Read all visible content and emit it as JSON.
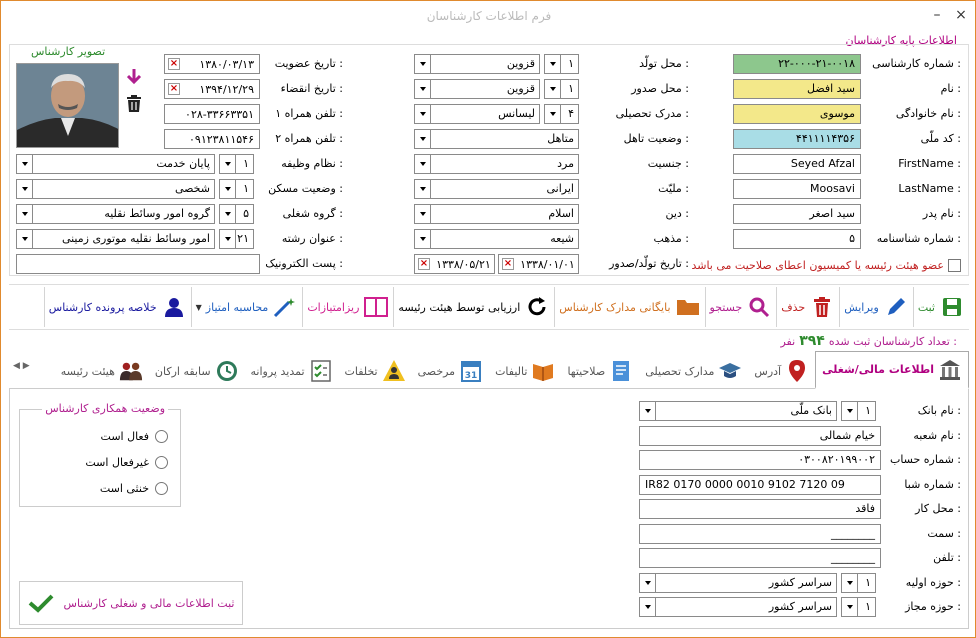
{
  "window": {
    "title": "فرم اطلاعات کارشناسان",
    "close": "×",
    "minimize": "–"
  },
  "section_title": "اطلاعات پایه کارشناسان",
  "photo_label": "تصویر کارشناس",
  "col1": [
    {
      "label": "شماره کارشناسی :",
      "value": "۲۲-۰۰۰-۲۱-۰۰۱۸"
    },
    {
      "label": "نام :",
      "value": "سید افضل"
    },
    {
      "label": "نام خانوادگی :",
      "value": "موسوی"
    },
    {
      "label": "کد ملّی :",
      "value": "۴۴۱۱۱۱۴۳۵۶"
    },
    {
      "label": "FirstName :",
      "value": "Seyed Afzal"
    },
    {
      "label": "LastName :",
      "value": "Moosavi"
    },
    {
      "label": "نام پدر :",
      "value": "سید اصغر"
    },
    {
      "label": "شماره شناسنامه :",
      "value": "۵"
    }
  ],
  "committee_check": "عضو هیئت رئیسه یا کمیسیون اعطای صلاحیت می باشد",
  "col2": [
    {
      "label": "محل تولّد :",
      "code": "۱",
      "value": "قزوین"
    },
    {
      "label": "محل صدور :",
      "code": "۱",
      "value": "قزوین"
    },
    {
      "label": "مدرک تحصیلی :",
      "code": "۴",
      "value": "لیسانس"
    },
    {
      "label": "وضعیت تاهل :",
      "code": "",
      "value": "متاهل"
    },
    {
      "label": "جنسیت :",
      "code": "",
      "value": "مرد"
    },
    {
      "label": "ملیّت :",
      "code": "",
      "value": "ایرانی"
    },
    {
      "label": "دین :",
      "code": "",
      "value": "اسلام"
    },
    {
      "label": "مذهب :",
      "code": "",
      "value": "شیعه"
    }
  ],
  "birth_issue": {
    "label": "تاریخ تولّد/صدور :",
    "birth": "۱۳۳۸/۰۱/۰۱",
    "issue": "۱۳۳۸/۰۵/۲۱"
  },
  "col3": [
    {
      "label": "تاریخ عضویت :",
      "value": "۱۳۸۰/۰۳/۱۳",
      "x": true
    },
    {
      "label": "تاریخ انقضاء :",
      "value": "۱۳۹۴/۱۲/۲۹",
      "x": true
    },
    {
      "label": "تلفن همراه ۱ :",
      "value": "۰۲۸-۳۳۶۶۳۳۵۱",
      "x": false
    },
    {
      "label": "تلفن همراه ۲ :",
      "value": "۰۹۱۲۳۸۱۱۵۴۶",
      "x": false
    }
  ],
  "col3_dd": [
    {
      "label": "نظام وظیفه :",
      "code": "۱",
      "value": "پایان خدمت"
    },
    {
      "label": "وضعیت مسکن :",
      "code": "۱",
      "value": "شخصی"
    },
    {
      "label": "گروه شغلی :",
      "code": "۵",
      "value": "گروه امور وسائط نقلیه"
    },
    {
      "label": "عنوان رشته :",
      "code": "۲۱",
      "value": "امور وسائط نقلیه موتوری زمینی"
    }
  ],
  "email_label": "پست الکترونیک :",
  "toolbar": [
    {
      "label": "ثبت",
      "icon": "save-icon",
      "color": "#2e8b2e"
    },
    {
      "label": "ویرایش",
      "icon": "edit-icon",
      "color": "#1f5fbf"
    },
    {
      "label": "حذف",
      "icon": "trash-icon",
      "color": "#c02020"
    },
    {
      "label": "جستجو",
      "icon": "search-icon",
      "color": "#b0208f"
    },
    {
      "label": "بایگانی مدارک کارشناس",
      "icon": "folder-icon",
      "color": "#d07020"
    },
    {
      "label": "ارزیابی توسط هیئت رئیسه",
      "icon": "refresh-icon",
      "color": "#000000"
    },
    {
      "label": "ریزامتیازات",
      "icon": "columns-icon",
      "color": "#d0208f"
    },
    {
      "label": "محاسبه امتیاز",
      "icon": "wand-icon",
      "color": "#1f5fbf"
    },
    {
      "label": "خلاصه پرونده کارشناس",
      "icon": "user-icon",
      "color": "#1a1a9f"
    }
  ],
  "count": {
    "label": "تعداد کارشناسان ثبت شده :",
    "value": "۳۹۴",
    "unit": "نفر"
  },
  "tabs": [
    {
      "label": "اطلاعات مالی/شغلی",
      "icon": "bank-icon",
      "active": true
    },
    {
      "label": "آدرس",
      "icon": "map-pin-icon"
    },
    {
      "label": "مدارک تحصیلی",
      "icon": "graduation-cap-icon"
    },
    {
      "label": "صلاحیتها",
      "icon": "document-icon"
    },
    {
      "label": "تالیفات",
      "icon": "book-icon"
    },
    {
      "label": "مرخصی",
      "icon": "calendar-icon"
    },
    {
      "label": "تخلفات",
      "icon": "warning-user-icon"
    },
    {
      "label": "تمدید پروانه",
      "icon": "checklist-icon"
    },
    {
      "label": "سابقه ارکان",
      "icon": "history-icon"
    },
    {
      "label": "هیئت رئیسه",
      "icon": "group-icon"
    }
  ],
  "finance": [
    {
      "label": "نام بانک :",
      "code": "۱",
      "value": "بانک ملّی",
      "type": "dd"
    },
    {
      "label": "نام شعبه :",
      "value": "خیام شمالی",
      "type": "field"
    },
    {
      "label": "شماره حساب :",
      "value": "۰۳۰۰۸۲۰۱۹۹۰۰۲",
      "type": "field"
    },
    {
      "label": "شماره شبا :",
      "value": "IR82 0170 0000 0010 9102 7120 09",
      "type": "field"
    },
    {
      "label": "محل کار :",
      "value": "فاقد",
      "type": "field"
    },
    {
      "label": "سمت :",
      "value": "________",
      "type": "field"
    },
    {
      "label": "تلفن :",
      "value": "________",
      "type": "field"
    },
    {
      "label": "حوزه اولیه :",
      "code": "۱",
      "value": "سراسر کشور",
      "type": "dd"
    },
    {
      "label": "حوزه مجاز :",
      "code": "۱",
      "value": "سراسر کشور",
      "type": "dd"
    }
  ],
  "coop": {
    "title": "وضعیت همکاری کارشناس",
    "options": [
      "فعال است",
      "غیرفعال است",
      "خنثی است"
    ]
  },
  "save_finance": "ثبت اطلاعات مالی و شغلی کارشناس"
}
